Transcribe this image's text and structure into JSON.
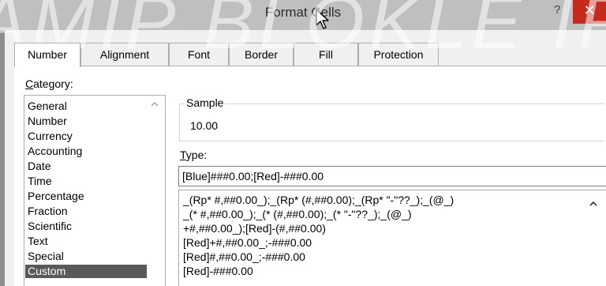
{
  "window": {
    "title": "Format Cells",
    "help_glyph": "?",
    "close_glyph": "✕",
    "watermark": "AMIP BLOKLE IRP"
  },
  "tabs": [
    {
      "label": "Number",
      "active": true
    },
    {
      "label": "Alignment",
      "active": false
    },
    {
      "label": "Font",
      "active": false
    },
    {
      "label": "Border",
      "active": false
    },
    {
      "label": "Fill",
      "active": false
    },
    {
      "label": "Protection",
      "active": false
    }
  ],
  "category": {
    "label_accel": "C",
    "label_rest": "ategory:",
    "items": [
      "General",
      "Number",
      "Currency",
      "Accounting",
      "Date",
      "Time",
      "Percentage",
      "Fraction",
      "Scientific",
      "Text",
      "Special",
      "Custom"
    ],
    "selected": "Custom"
  },
  "sample": {
    "legend": "Sample",
    "value": "10.00"
  },
  "type": {
    "label_accel": "T",
    "label_rest": "ype:",
    "value": "[Blue]###0.00;[Red]-###0.00"
  },
  "format_list": [
    "_(Rp* #,##0.00_);_(Rp* (#,##0.00);_(Rp* \"-\"??_);_(@_)",
    "_(* #,##0.00_);_(* (#,##0.00);_(* \"-\"??_);_(@_)",
    "+#,##0.00_);[Red]-(#,##0.00)",
    "[Red]+#,##0.00_;-###0.00",
    "[Red]#,##0.00_;-###0.00",
    "[Red]-###0.00"
  ],
  "colors": {
    "title_bar": "#bfbfbf",
    "close_button": "#c42b1c",
    "selected_item": "#595959"
  }
}
